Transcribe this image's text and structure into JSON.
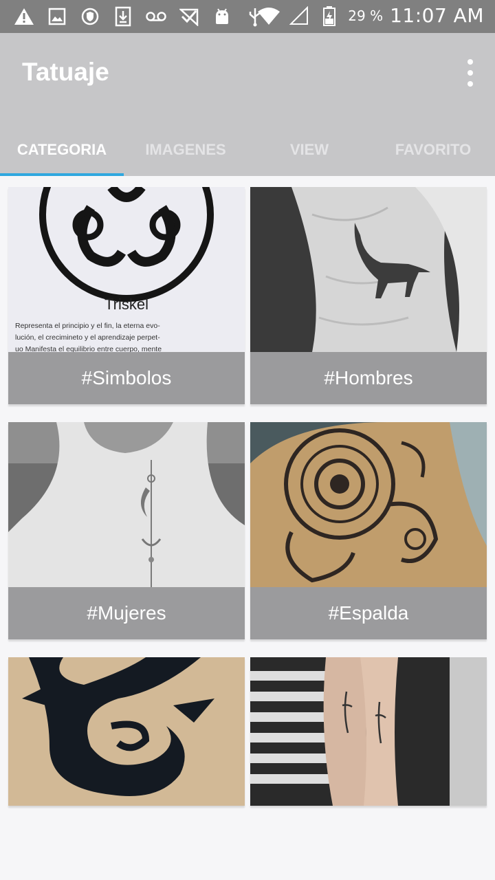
{
  "status_bar": {
    "battery_percent": "29 %",
    "time": "11:07 AM",
    "icons": [
      "warning-icon",
      "image-icon",
      "shield-icon",
      "download-icon",
      "voicemail-icon",
      "check-icon",
      "android-icon",
      "usb-icon",
      "wifi-icon",
      "signal-icon",
      "battery-icon"
    ]
  },
  "app_bar": {
    "title": "Tatuaje",
    "menu_icon": "more-vert-icon"
  },
  "tabs": [
    {
      "label": "CATEGORIA",
      "active": true
    },
    {
      "label": "IMAGENES",
      "active": false
    },
    {
      "label": "VIEW",
      "active": false
    },
    {
      "label": "FAVORITO",
      "active": false
    }
  ],
  "categories": [
    {
      "label": "#Simbolos",
      "image": "triskel-tattoo",
      "image_caption": "Triskel",
      "image_text": "Representa el principio y el fin, la eterna evo- lución, el crecimineto y el aprendizaje perpet- uo Manifesta el equilibrio entre cuerpo, mente"
    },
    {
      "label": "#Hombres",
      "image": "wolf-rib-tattoo"
    },
    {
      "label": "#Mujeres",
      "image": "neck-moon-tattoo"
    },
    {
      "label": "#Espalda",
      "image": "mandala-back-tattoo"
    },
    {
      "label": "",
      "image": "tribal-tattoo"
    },
    {
      "label": "",
      "image": "forearm-script-tattoo"
    }
  ],
  "colors": {
    "status_bar": "#808080",
    "app_bar": "#c6c6c8",
    "tab_indicator": "#2fa8df",
    "card_label": "#9b9b9d",
    "background": "#f6f6f8"
  }
}
